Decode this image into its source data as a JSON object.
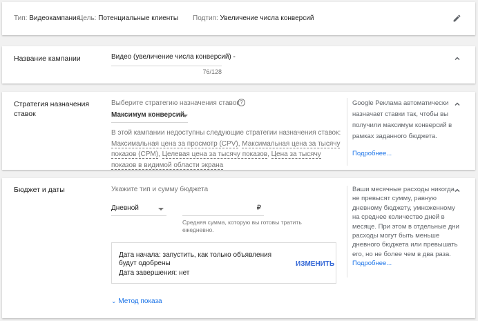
{
  "summary": {
    "type_label": "Тип:",
    "type_value": "Видеокампания",
    "goal_label": "Цель:",
    "goal_value": "Потенциальные клиенты",
    "subtype_label": "Подтип:",
    "subtype_value": "Увеличение числа конверсий"
  },
  "name_section": {
    "title": "Название кампании",
    "value": "Видео (увеличение числа конверсий) -",
    "counter": "76/128"
  },
  "bidding": {
    "title_line1": "Стратегия назначения",
    "title_line2": "ставок",
    "hint": "Выберите стратегию назначения ставок",
    "selected": "Максимум конверсий",
    "unavailable_intro": "В этой кампании недоступны следующие стратегии назначения ставок:",
    "unavailable": [
      "Максимальная цена за просмотр (CPV)",
      "Максимальная цена за тысячу показов (CPM)",
      "Целевая цена за тысячу показов",
      "Цена за тысячу показов в видимой области экрана"
    ],
    "side_text": "Google Реклама автоматически назначает ставки так, чтобы вы получили максимум конверсий в рамках заданного бюджета.",
    "side_link": "Подробнее..."
  },
  "budget": {
    "title": "Бюджет и даты",
    "hint": "Укажите тип и сумму бюджета",
    "type": "Дневной",
    "currency": "₽",
    "amount_help": "Средняя сумма, которую вы готовы тратить ежедневно.",
    "start_date": "Дата начала: запустить, как только объявления будут одобрены",
    "end_date": "Дата завершения: нет",
    "change_label": "ИЗМЕНИТЬ",
    "delivery_label": "Метод показа",
    "side_text": "Ваши месячные расходы никогда не превысят сумму, равную дневному бюджету, умноженному на среднее количество дней в месяце. При этом в отдельные дни расходы могут быть меньше дневного бюджета или превышать его, но не более чем в два раза.",
    "side_link": "Подробнее..."
  },
  "colors": {
    "accent": "#1a73e8",
    "change": "#3367d6"
  }
}
